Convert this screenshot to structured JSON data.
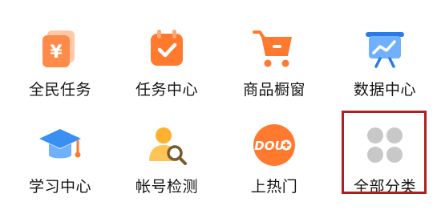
{
  "menu": {
    "items": [
      {
        "label": "全民任务",
        "icon": "money-cards-icon"
      },
      {
        "label": "任务中心",
        "icon": "calendar-check-icon"
      },
      {
        "label": "商品橱窗",
        "icon": "shopping-cart-icon"
      },
      {
        "label": "数据中心",
        "icon": "data-board-icon"
      },
      {
        "label": "学习中心",
        "icon": "graduation-cap-icon"
      },
      {
        "label": "帐号检测",
        "icon": "user-search-icon"
      },
      {
        "label": "上热门",
        "icon": "dou-plus-icon"
      },
      {
        "label": "全部分类",
        "icon": "four-dots-icon"
      }
    ]
  },
  "highlight_color": "#b11e21",
  "icon_colors": {
    "orange": "#ff7a2e",
    "blue": "#3a8ff2",
    "gray": "#c8c8c8"
  },
  "logo_text": "DOU"
}
